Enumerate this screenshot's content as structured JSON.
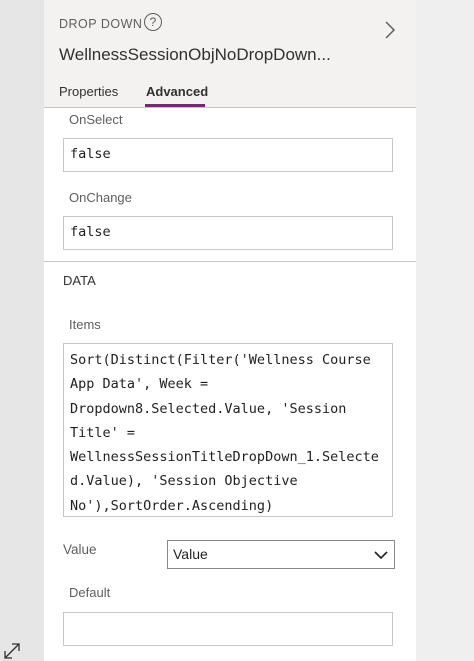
{
  "panel": {
    "control_type": "DROP DOWN",
    "control_name": "WellnessSessionObjNoDropDown...",
    "help_icon": "help-circle-icon",
    "expand_icon": "chevron-right-icon"
  },
  "tabs": [
    {
      "label": "Properties",
      "active": false
    },
    {
      "label": "Advanced",
      "active": true
    }
  ],
  "accent_color": "#742774",
  "actions": {
    "onselect_label": "OnSelect",
    "onselect_value": "false",
    "onchange_label": "OnChange",
    "onchange_value": "false"
  },
  "data_section": {
    "title": "DATA",
    "items_label": "Items",
    "items_formula_lines": [
      "Sort(Distinct(Filter('Wellness Course",
      "App Data', Week =",
      "Dropdown8.Selected.Value, 'Session",
      "Title' =",
      "WellnessSessionTitleDropDown_1.Selecte",
      "d.Value), 'Session Objective",
      "No'),SortOrder.Ascending)"
    ],
    "value_label": "Value",
    "value_selected": "Value",
    "default_label": "Default",
    "default_value": ""
  },
  "resize_icon": "resize-diagonal-icon"
}
